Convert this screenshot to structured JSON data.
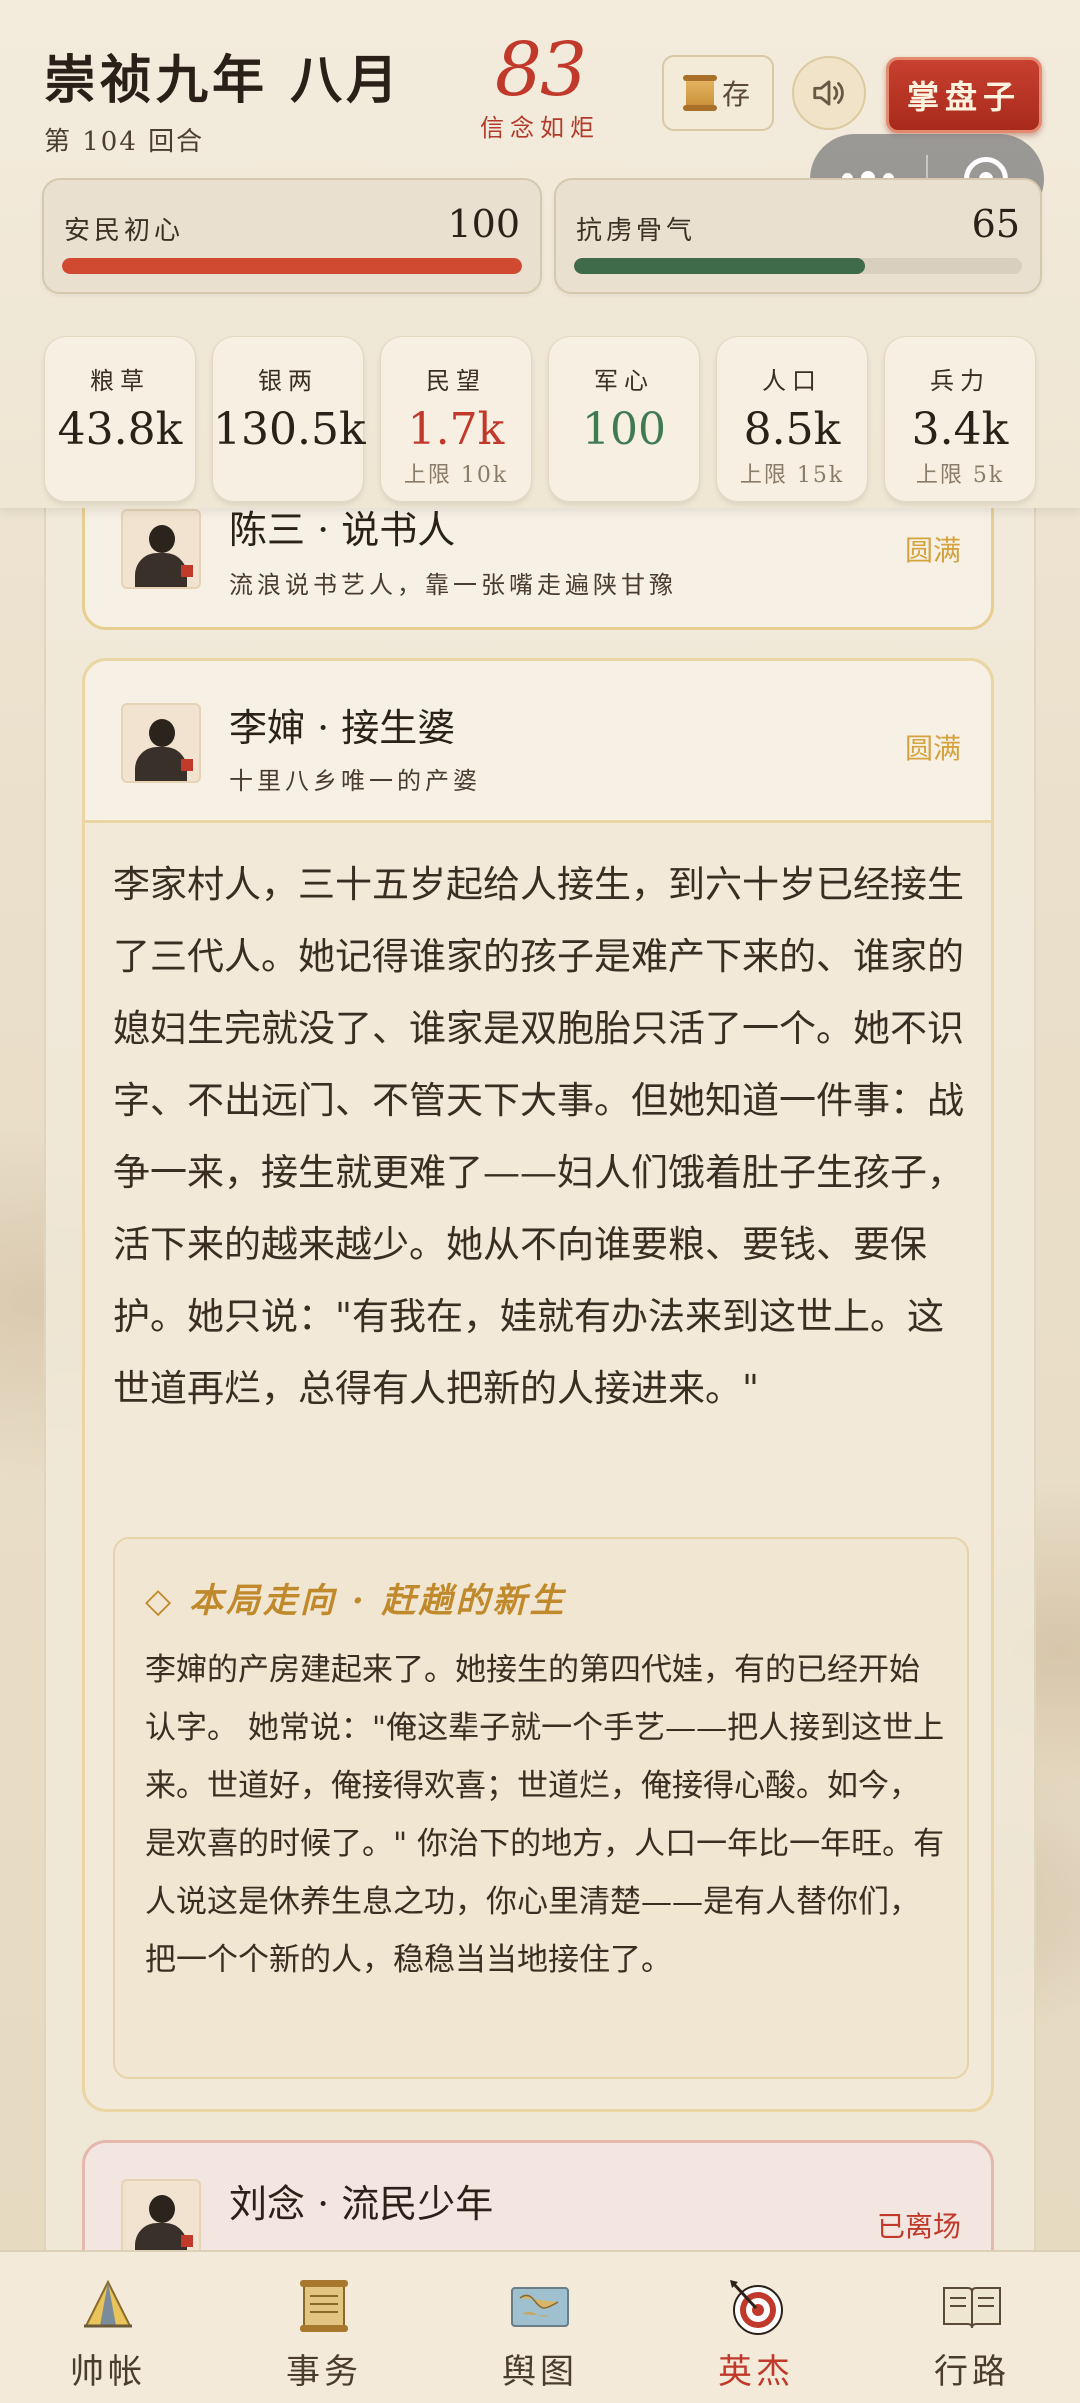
{
  "header": {
    "title": "崇祯九年 八月",
    "turn": "第 104 回合",
    "faith_value": "83",
    "faith_label": "信念如炬",
    "save_label": "存",
    "boss_label": "掌盘子"
  },
  "meters": [
    {
      "label": "安民初心",
      "value": "100",
      "fill": 1.0,
      "color": "#d04a32"
    },
    {
      "label": "抗虏骨气",
      "value": "65",
      "fill": 0.65,
      "color": "#3f6b4a"
    }
  ],
  "stats": [
    {
      "label": "粮草",
      "value": "43.8k",
      "cap": "",
      "color": "#2b2118"
    },
    {
      "label": "银两",
      "value": "130.5k",
      "cap": "",
      "color": "#2b2118"
    },
    {
      "label": "民望",
      "value": "1.7k",
      "cap": "上限 10k",
      "color": "#c0392b"
    },
    {
      "label": "军心",
      "value": "100",
      "cap": "",
      "color": "#3f7a52"
    },
    {
      "label": "人口",
      "value": "8.5k",
      "cap": "上限 15k",
      "color": "#2b2118"
    },
    {
      "label": "兵力",
      "value": "3.4k",
      "cap": "上限 5k",
      "color": "#2b2118"
    }
  ],
  "people": [
    {
      "name": "陈三 · 说书人",
      "desc": "流浪说书艺人，靠一张嘴走遍陕甘豫",
      "status": "圆满"
    },
    {
      "name": "李婶 · 接生婆",
      "desc": "十里八乡唯一的产婆",
      "status": "圆满"
    },
    {
      "name": "刘念 · 流民少年",
      "desc": "",
      "status": "已离场"
    }
  ],
  "bio": "李家村人，三十五岁起给人接生，到六十岁已经接生了三代人。她记得谁家的孩子是难产下来的、谁家的媳妇生完就没了、谁家是双胞胎只活了一个。她不识字、不出远门、不管天下大事。但她知道一件事：战争一来，接生就更难了——妇人们饿着肚子生孩子，活下来的越来越少。她从不向谁要粮、要钱、要保护。她只说：\"有我在，娃就有办法来到这世上。这世道再烂，总得有人把新的人接进来。\"",
  "outcome": {
    "title": "◇ 本局走向 · 赶趟的新生",
    "body": "李婶的产房建起来了。她接生的第四代娃，有的已经开始认字。 她常说：\"俺这辈子就一个手艺——把人接到这世上来。世道好，俺接得欢喜；世道烂，俺接得心酸。如今，是欢喜的时候了。\" 你治下的地方，人口一年比一年旺。有人说这是休养生息之功，你心里清楚——是有人替你们，把一个个新的人，稳稳当当地接住了。"
  },
  "tabs": [
    {
      "label": "帅帐",
      "icon": "tent-icon",
      "active": false
    },
    {
      "label": "事务",
      "icon": "scroll-icon",
      "active": false
    },
    {
      "label": "舆图",
      "icon": "map-icon",
      "active": false
    },
    {
      "label": "英杰",
      "icon": "target-icon",
      "active": true
    },
    {
      "label": "行路",
      "icon": "book-icon",
      "active": false
    }
  ]
}
